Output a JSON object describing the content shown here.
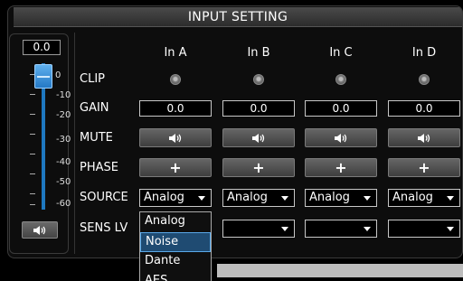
{
  "title": "INPUT SETTING",
  "fader": {
    "value": "0.0",
    "scale": [
      "0",
      "-10",
      "-20",
      "-30",
      "-40",
      "-50",
      "-60"
    ],
    "mute_icon": "speaker-icon"
  },
  "rows": {
    "clip": "CLIP",
    "gain": "GAIN",
    "mute": "MUTE",
    "phase": "PHASE",
    "source": "SOURCE",
    "sens": "SENS LV"
  },
  "channels": [
    {
      "name": "In A",
      "gain": "0.0",
      "source": "Analog",
      "sens": ""
    },
    {
      "name": "In B",
      "gain": "0.0",
      "source": "Analog",
      "sens": ""
    },
    {
      "name": "In C",
      "gain": "0.0",
      "source": "Analog",
      "sens": ""
    },
    {
      "name": "In D",
      "gain": "0.0",
      "source": "Analog",
      "sens": ""
    }
  ],
  "phase_symbol": "+",
  "source_dropdown": {
    "options": [
      "Analog",
      "Noise",
      "Dante",
      "AES"
    ],
    "highlighted": "Noise"
  },
  "colors": {
    "fader_accent": "#1e78c0",
    "highlight": "#1f4b72"
  }
}
